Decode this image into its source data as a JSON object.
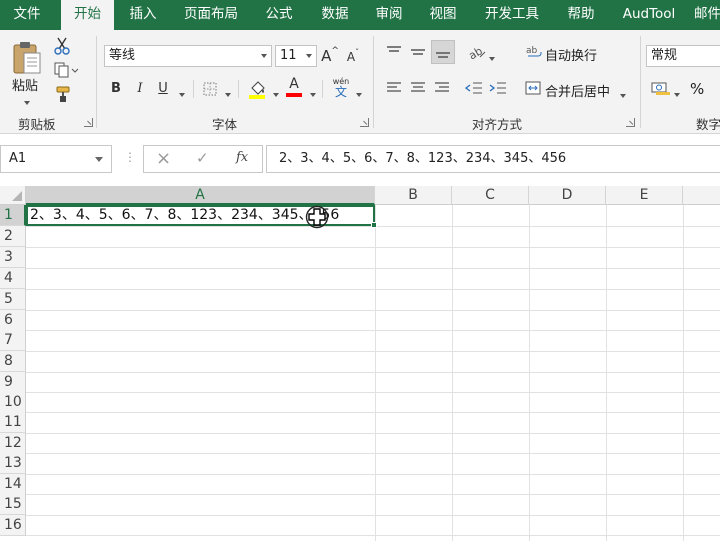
{
  "tabs": [
    "文件",
    "开始",
    "插入",
    "页面布局",
    "公式",
    "数据",
    "审阅",
    "视图",
    "开发工具",
    "帮助",
    "AudTool",
    "邮件"
  ],
  "active_tab_index": 1,
  "ribbon": {
    "clipboard": {
      "paste_label": "粘贴",
      "group_label": "剪贴板"
    },
    "font": {
      "font_name": "等线",
      "font_size": "11",
      "grow_label": "A",
      "shrink_label": "A",
      "phonetic_top": "wén",
      "phonetic_bottom": "文",
      "bold_label": "B",
      "italic_label": "I",
      "underline_label": "U",
      "font_color_label": "A",
      "group_label": "字体",
      "highlight_color": "#ffff00",
      "font_color": "#ff0000"
    },
    "alignment": {
      "wrap_text_label": "自动换行",
      "merge_center_label": "合并后居中",
      "group_label": "对齐方式"
    },
    "number": {
      "format": "常规",
      "percent_label": "%",
      "group_label": "数字"
    }
  },
  "formula_bar": {
    "name_box": "A1",
    "cancel_icon": "×",
    "enter_icon": "✓",
    "fx_label": "fx",
    "content": "2、3、4、5、6、7、8、123、234、345、456"
  },
  "grid": {
    "columns": [
      "A",
      "B",
      "C",
      "D",
      "E"
    ],
    "rows": [
      "1",
      "2",
      "3",
      "4",
      "5",
      "6",
      "7",
      "8",
      "9",
      "10",
      "11",
      "12",
      "13",
      "14",
      "15",
      "16"
    ],
    "selected_cell": "A1",
    "cells": {
      "A1": "2、3、4、5、6、7、8、123、234、345、456"
    }
  },
  "colors": {
    "accent": "#217346",
    "ribbon_bg": "#f3f3f3",
    "gridline": "#e1e1e1"
  }
}
